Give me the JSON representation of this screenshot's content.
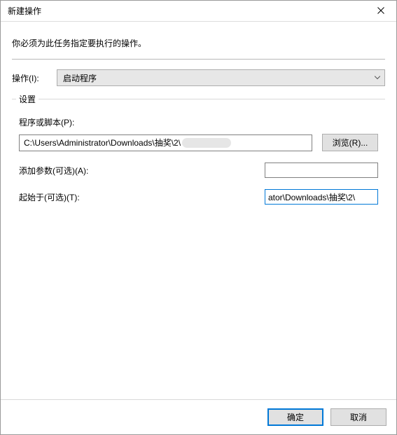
{
  "title": "新建操作",
  "instruction": "你必须为此任务指定要执行的操作。",
  "action": {
    "label": "操作(I):",
    "selected": "启动程序"
  },
  "settings": {
    "legend": "设置",
    "program": {
      "label": "程序或脚本(P):",
      "value": "C:\\Users\\Administrator\\Downloads\\抽奖\\2\\",
      "browse": "浏览(R)..."
    },
    "arguments": {
      "label": "添加参数(可选)(A):",
      "value": ""
    },
    "startin": {
      "label": "起始于(可选)(T):",
      "value": "ator\\Downloads\\抽奖\\2\\"
    }
  },
  "buttons": {
    "ok": "确定",
    "cancel": "取消"
  }
}
